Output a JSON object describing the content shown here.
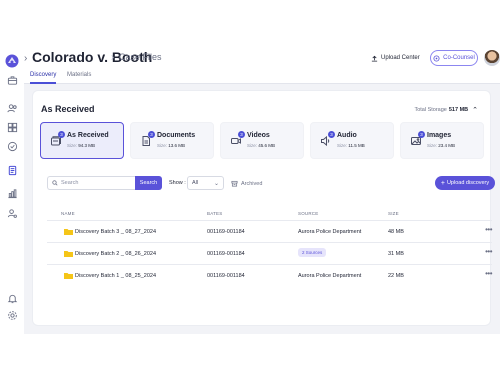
{
  "header": {
    "case_title": "Colorado v. Booth",
    "page": "Case Files",
    "upload_center_label": "Upload Center",
    "co_counsel_label": "Co-Counsel"
  },
  "tabs": [
    {
      "label": "Discovery",
      "active": true
    },
    {
      "label": "Materials",
      "active": false
    }
  ],
  "section": {
    "title": "As Received",
    "storage_label": "Total Storage",
    "storage_value": "517 MB"
  },
  "categories": [
    {
      "name": "As Received",
      "size_label": "Size",
      "size": "94.3 MB",
      "badge": "3",
      "icon": "folder-stack-icon",
      "selected": true
    },
    {
      "name": "Documents",
      "size_label": "Size",
      "size": "13.6 MB",
      "badge": "3",
      "icon": "document-icon",
      "selected": false
    },
    {
      "name": "Videos",
      "size_label": "Size",
      "size": "45.6 MB",
      "badge": "3",
      "icon": "video-icon",
      "selected": false
    },
    {
      "name": "Audio",
      "size_label": "Size",
      "size": "11.5 MB",
      "badge": "3",
      "icon": "audio-icon",
      "selected": false
    },
    {
      "name": "Images",
      "size_label": "Size",
      "size": "23.4 MB",
      "badge": "3",
      "icon": "image-icon",
      "selected": false
    }
  ],
  "toolbar": {
    "search_placeholder": "Search",
    "search_button": "Search",
    "show_label": "Show :",
    "show_value": "All",
    "archived_label": "Archived",
    "upload_button": "Upload discovery"
  },
  "table": {
    "columns": [
      "NAME",
      "BATES",
      "SOURCE",
      "SIZE"
    ],
    "rows": [
      {
        "name": "Discovery Batch 3 _ 08_27_2024",
        "bates": "001169-001184",
        "source": "Aurora Police Department",
        "source_is_pill": false,
        "size": "48 MB"
      },
      {
        "name": "Discovery Batch 2 _ 08_26_2024",
        "bates": "001169-001184",
        "source": "2 Sources",
        "source_is_pill": true,
        "size": "31 MB"
      },
      {
        "name": "Discovery Batch 1 _ 08_25_2024",
        "bates": "001169-001184",
        "source": "Aurora Police Department",
        "source_is_pill": false,
        "size": "22 MB"
      }
    ]
  },
  "colors": {
    "accent": "#5a52d9",
    "folder": "#f5c518",
    "background": "#f2f3f7"
  }
}
